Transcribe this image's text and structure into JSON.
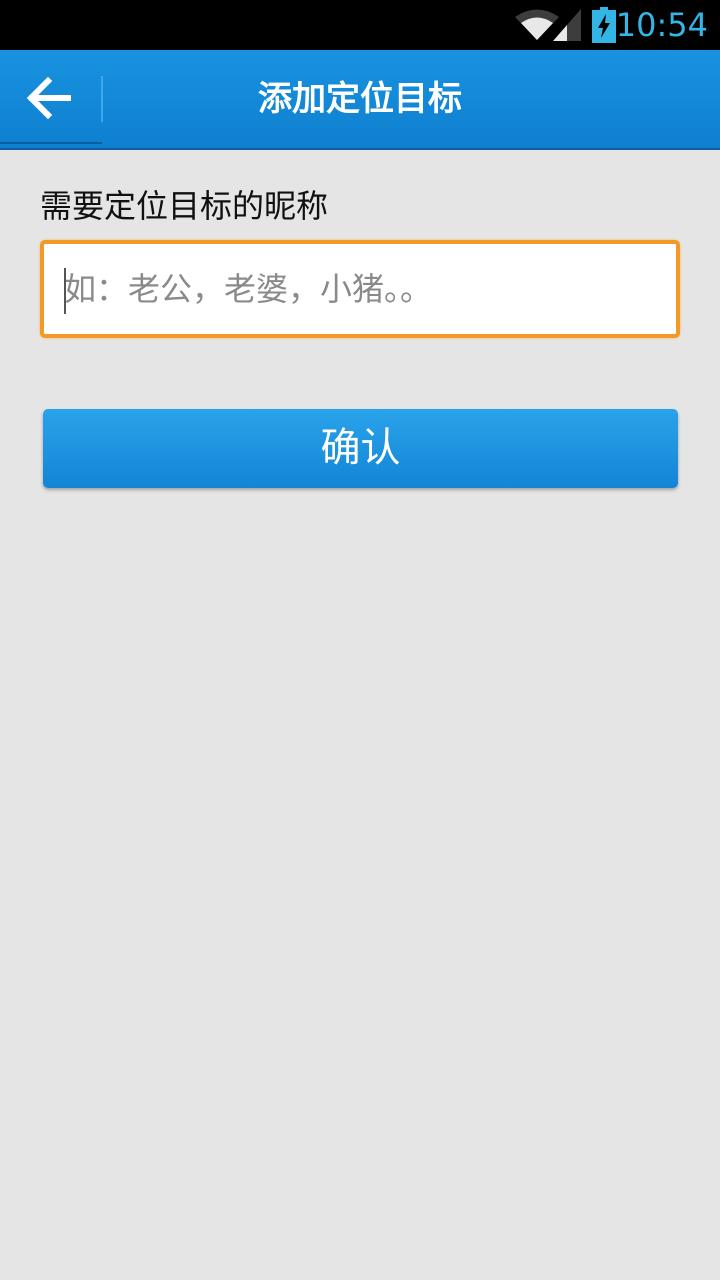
{
  "status_bar": {
    "time": "10:54",
    "icons": [
      "wifi-icon",
      "signal-icon",
      "battery-charging-icon"
    ],
    "clock_color": "#33b5e5"
  },
  "action_bar": {
    "title": "添加定位目标",
    "back_icon": "back-arrow-icon",
    "background_color": "#1289d8"
  },
  "form": {
    "label": "需要定位目标的昵称",
    "nickname_value": "",
    "nickname_placeholder": "如：老公，老婆，小猪。。",
    "focus_border_color": "#f39a26"
  },
  "confirm_button": {
    "label": "确认",
    "color": "#1b93e0"
  }
}
